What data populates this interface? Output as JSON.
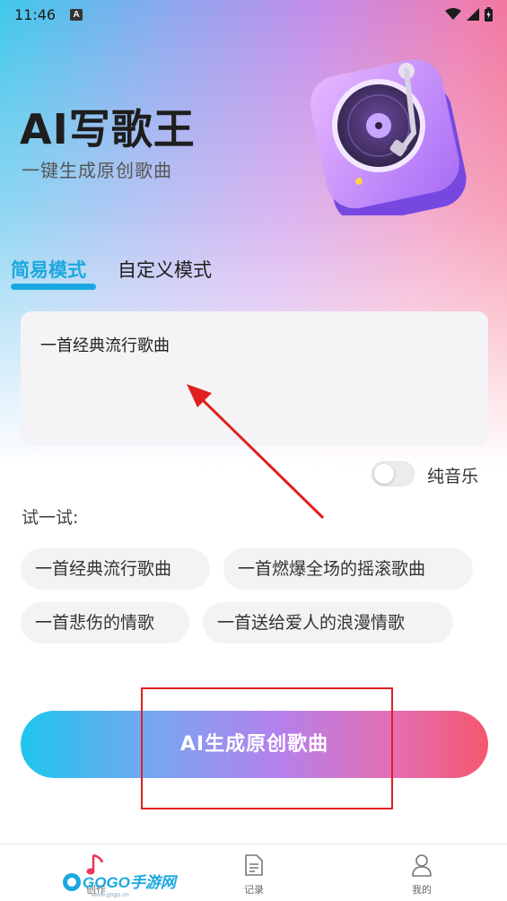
{
  "status_bar": {
    "time": "11:46",
    "notice": "A"
  },
  "header": {
    "title": "AI写歌王",
    "subtitle": "一键生成原创歌曲"
  },
  "tabs": [
    {
      "label": "简易模式",
      "active": true
    },
    {
      "label": "自定义模式",
      "active": false
    }
  ],
  "prompt": {
    "value": "一首经典流行歌曲"
  },
  "instrumental": {
    "label": "纯音乐",
    "enabled": false
  },
  "suggestions": {
    "label": "试一试:",
    "items": [
      "一首经典流行歌曲",
      "一首燃爆全场的摇滚歌曲",
      "一首悲伤的情歌",
      "一首送给爱人的浪漫情歌"
    ]
  },
  "generate": {
    "label": "AI生成原创歌曲"
  },
  "bottom_nav": {
    "items": [
      {
        "label": "创作",
        "icon": "music-note-icon"
      },
      {
        "label": "记录",
        "icon": "document-icon"
      },
      {
        "label": "我的",
        "icon": "person-icon"
      }
    ]
  },
  "watermark": {
    "text": "GOGO手游网",
    "url": "www.gogo.cn"
  },
  "colors": {
    "accent": "#1ba8e0",
    "annotation_red": "#e02020",
    "button_gradient_start": "#1ec6ec",
    "button_gradient_end": "#f5576f"
  }
}
